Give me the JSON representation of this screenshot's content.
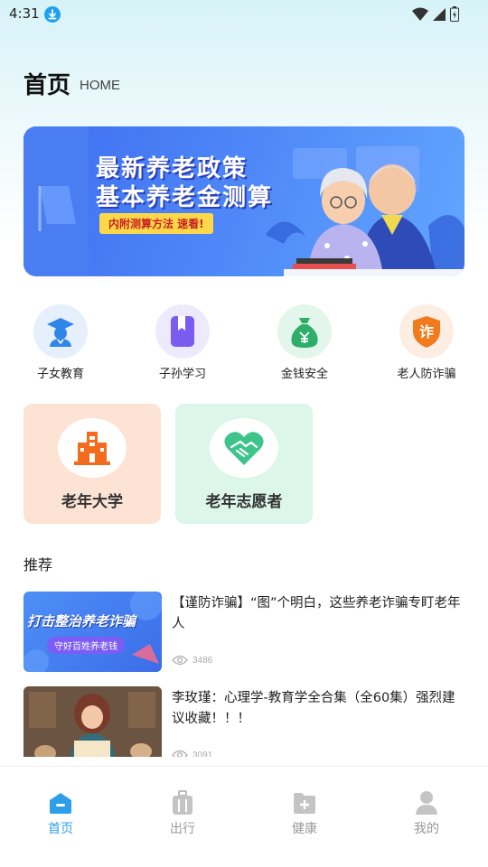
{
  "status": {
    "time": "4:31"
  },
  "header": {
    "title": "首页",
    "subtitle": "HOME"
  },
  "banner": {
    "line1": "最新养老政策",
    "line2": "基本养老金测算",
    "tag": "内附测算方法 速看!"
  },
  "quick_links": [
    {
      "label": "子女教育",
      "icon": "graduate-icon",
      "color": "#2f86e8"
    },
    {
      "label": "子孙学习",
      "icon": "bookmark-book-icon",
      "color": "#7a5cf0"
    },
    {
      "label": "金钱安全",
      "icon": "money-bag-icon",
      "color": "#2fae6a"
    },
    {
      "label": "老人防诈骗",
      "icon": "anti-fraud-shield-icon",
      "color": "#f07a1c"
    }
  ],
  "feature_cards": [
    {
      "label": "老年大学",
      "icon": "building-icon",
      "bg": "#fde3d3"
    },
    {
      "label": "老年志愿者",
      "icon": "heart-handshake-icon",
      "bg": "#dcf6ea"
    }
  ],
  "recommend": {
    "title": "推荐",
    "items": [
      {
        "title": "【谨防诈骗】“图”个明白，这些养老诈骗专盯老年人",
        "thumb_line1": "打击整治养老诈骗",
        "thumb_line2": "守好百姓养老钱",
        "views": "3486"
      },
      {
        "title": "李玫瑾：心理学-教育学全合集（全60集）强烈建议收藏！！！",
        "views": "3091"
      }
    ]
  },
  "tabs": [
    {
      "label": "首页",
      "icon": "home-icon",
      "active": true
    },
    {
      "label": "出行",
      "icon": "luggage-icon",
      "active": false
    },
    {
      "label": "健康",
      "icon": "medical-folder-icon",
      "active": false
    },
    {
      "label": "我的",
      "icon": "user-icon",
      "active": false
    }
  ],
  "colors": {
    "accent": "#2f9ee8",
    "banner": "#4d86f7"
  }
}
